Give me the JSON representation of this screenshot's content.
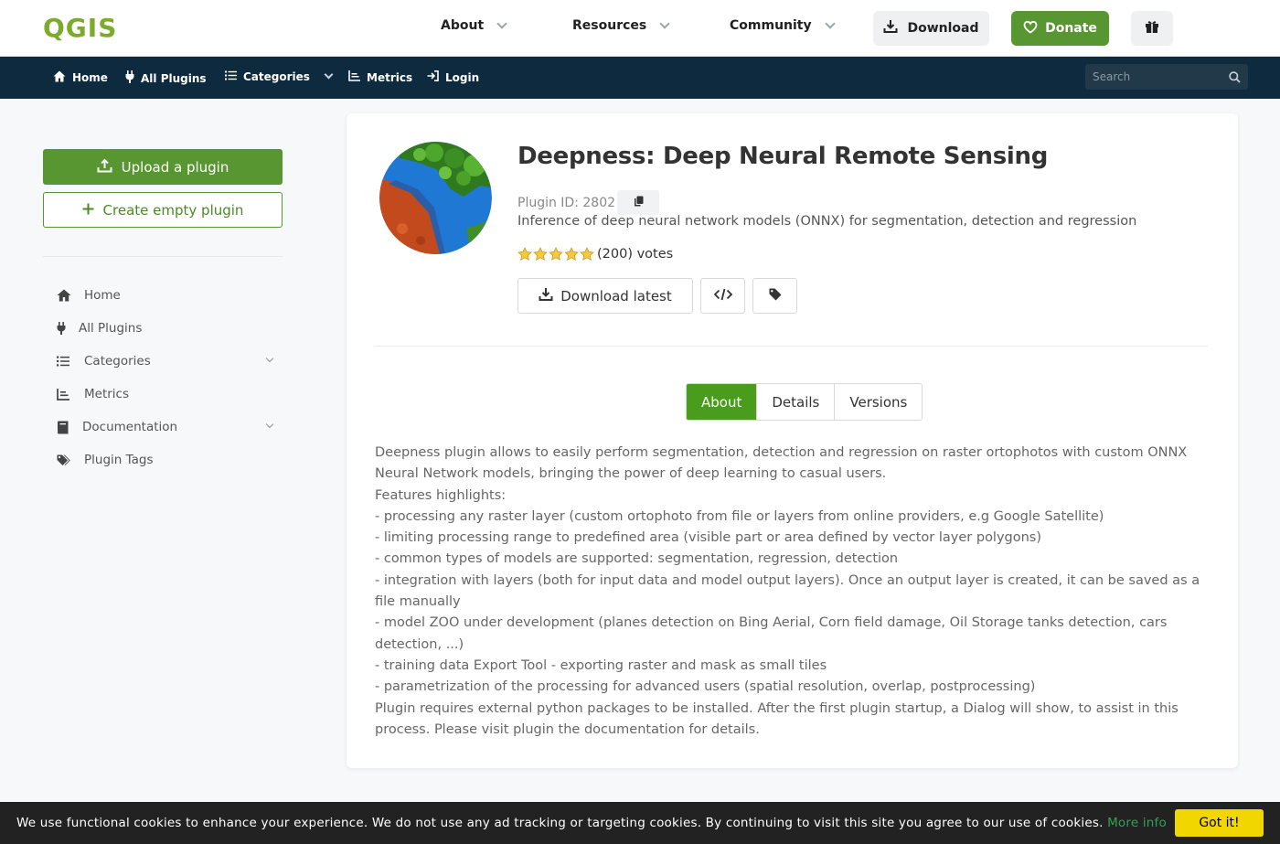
{
  "header": {
    "logo": "QGIS",
    "nav": [
      {
        "label": "About"
      },
      {
        "label": "Resources"
      },
      {
        "label": "Community"
      }
    ],
    "download_label": "Download",
    "donate_label": "Donate"
  },
  "subnav": {
    "items": [
      {
        "label": "Home"
      },
      {
        "label": "All Plugins"
      },
      {
        "label": "Categories"
      },
      {
        "label": "Metrics"
      },
      {
        "label": "Login"
      }
    ],
    "search_placeholder": "Search"
  },
  "sidebar": {
    "upload_label": "Upload a plugin",
    "create_label": "Create empty plugin",
    "items": [
      {
        "label": "Home"
      },
      {
        "label": "All Plugins"
      },
      {
        "label": "Categories"
      },
      {
        "label": "Metrics"
      },
      {
        "label": "Documentation"
      },
      {
        "label": "Plugin Tags"
      }
    ]
  },
  "plugin": {
    "title": "Deepness: Deep Neural Remote Sensing",
    "id_label": "Plugin ID: 2802",
    "description": "Inference of deep neural network models (ONNX) for segmentation, detection and regression",
    "rating_stars": 5,
    "votes": "(200) votes",
    "download_latest_label": "Download latest"
  },
  "tabs": [
    {
      "label": "About",
      "active": true
    },
    {
      "label": "Details",
      "active": false
    },
    {
      "label": "Versions",
      "active": false
    }
  ],
  "about_lines": [
    "Deepness plugin allows to easily perform segmentation, detection and regression on raster ortophotos with custom ONNX Neural Network models, bringing the power of deep learning to casual users.",
    "Features highlights:",
    "- processing any raster layer (custom ortophoto from file or layers from online providers, e.g Google Satellite)",
    "- limiting processing range to predefined area (visible part or area defined by vector layer polygons)",
    "- common types of models are supported: segmentation, regression, detection",
    "- integration with layers (both for input data and model output layers). Once an output layer is created, it can be saved as a file manually",
    "- model ZOO under development (planes detection on Bing Aerial, Corn field damage, Oil Storage tanks detection, cars detection, ...)",
    "- training data Export Tool - exporting raster and mask as small tiles",
    "- parametrization of the processing for advanced users (spatial resolution, overlap, postprocessing)",
    "Plugin requires external python packages to be installed. After the first plugin startup, a Dialog will show, to assist in this process. Please visit plugin the documentation for details."
  ],
  "cookie": {
    "text": "We use functional cookies to enhance your experience. We do not use any ad tracking or targeting cookies. By continuing to visit this site you agree to our use of cookies.",
    "more_info": "More info",
    "accept": "Got it!"
  },
  "colors": {
    "brand_green": "#589632",
    "navy": "#0d2a3e",
    "tab_active": "#4a9c1c",
    "cookie_button": "#f1d600"
  }
}
